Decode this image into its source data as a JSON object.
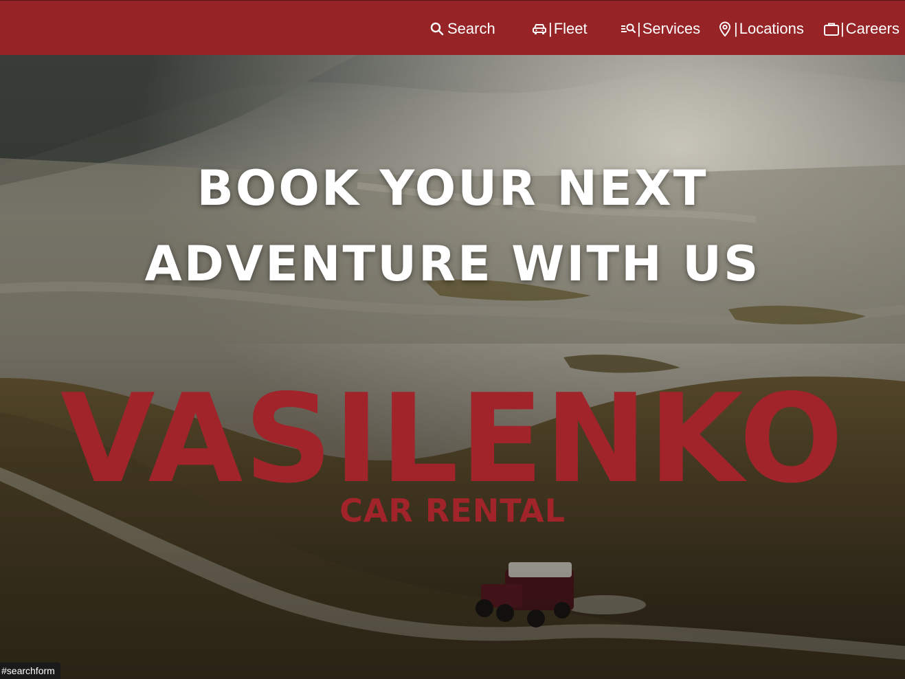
{
  "nav": {
    "items": [
      {
        "label": "Search",
        "icon": "search-icon",
        "separator": ""
      },
      {
        "label": "Fleet",
        "icon": "car-icon",
        "separator": "|"
      },
      {
        "label": "Services",
        "icon": "list-search-icon",
        "separator": "|"
      },
      {
        "label": "Locations",
        "icon": "map-pin-icon",
        "separator": "|"
      },
      {
        "label": "Careers",
        "icon": "briefcase-icon",
        "separator": "|"
      }
    ]
  },
  "hero": {
    "headline_line1": "BOOK YOUR NEXT",
    "headline_line2": "ADVENTURE WITH US",
    "brand_name": "VASILENKO",
    "brand_tagline": "CAR RENTAL"
  },
  "status_hint": "#searchform",
  "colors": {
    "navbar": "#962326",
    "brand": "#a0242a",
    "text_light": "#ffffff"
  }
}
